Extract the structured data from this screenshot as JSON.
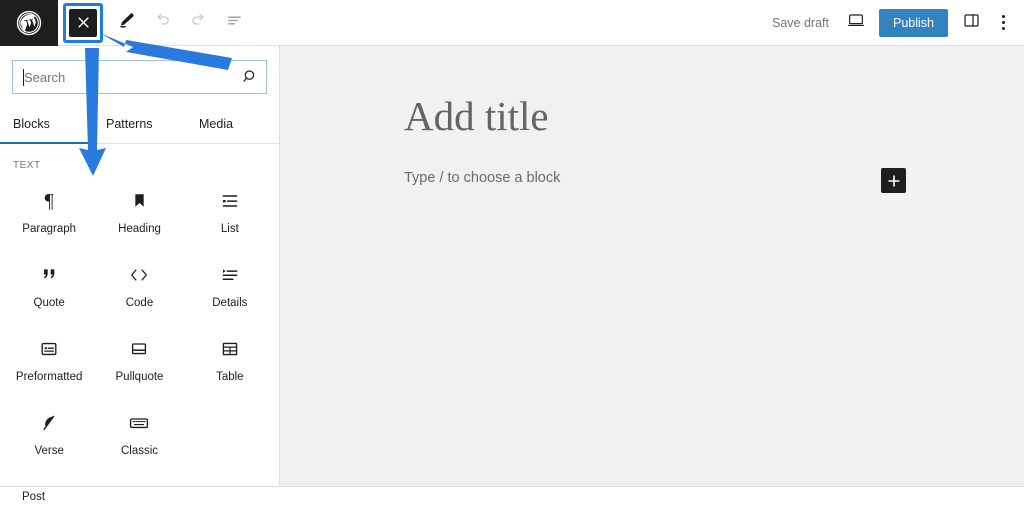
{
  "topbar": {
    "wp_logo": "wordpress-logo",
    "close_inserter_label": "×",
    "edit_tool": "pencil-icon",
    "undo_tool": "undo-icon",
    "redo_tool": "redo-icon",
    "details_tool": "document-overview-icon",
    "save_draft_label": "Save draft",
    "preview_label": "preview-icon",
    "publish_label": "Publish",
    "sidebar_toggle_label": "settings-sidebar-icon",
    "options_label": "options-menu-icon"
  },
  "inserter": {
    "search": {
      "value": "",
      "placeholder": "Search"
    },
    "tabs": [
      {
        "label": "Blocks",
        "active": true
      },
      {
        "label": "Patterns",
        "active": false
      },
      {
        "label": "Media",
        "active": false
      }
    ],
    "section_title": "TEXT",
    "blocks": [
      {
        "label": "Paragraph",
        "icon": "paragraph-icon"
      },
      {
        "label": "Heading",
        "icon": "heading-icon"
      },
      {
        "label": "List",
        "icon": "list-icon"
      },
      {
        "label": "Quote",
        "icon": "quote-icon"
      },
      {
        "label": "Code",
        "icon": "code-icon"
      },
      {
        "label": "Details",
        "icon": "details-icon"
      },
      {
        "label": "Preformatted",
        "icon": "preformatted-icon"
      },
      {
        "label": "Pullquote",
        "icon": "pullquote-icon"
      },
      {
        "label": "Table",
        "icon": "table-icon"
      },
      {
        "label": "Verse",
        "icon": "verse-icon"
      },
      {
        "label": "Classic",
        "icon": "classic-icon"
      }
    ]
  },
  "canvas": {
    "title_placeholder": "Add title",
    "body_placeholder": "Type / to choose a block",
    "add_block_label": "+"
  },
  "bottombar": {
    "breadcrumb": "Post"
  },
  "annotations": {
    "arrow_color": "#2a7ade",
    "arrow_up_name": "arrow-pointing-to-close-inserter",
    "arrow_down_name": "arrow-pointing-to-block-list"
  },
  "colors": {
    "accent": "#3383c3",
    "focus_ring": "#1a7ee0",
    "dark": "#1e1e1e",
    "canvas_bg": "#f1f1f1",
    "muted_text": "#757575"
  }
}
